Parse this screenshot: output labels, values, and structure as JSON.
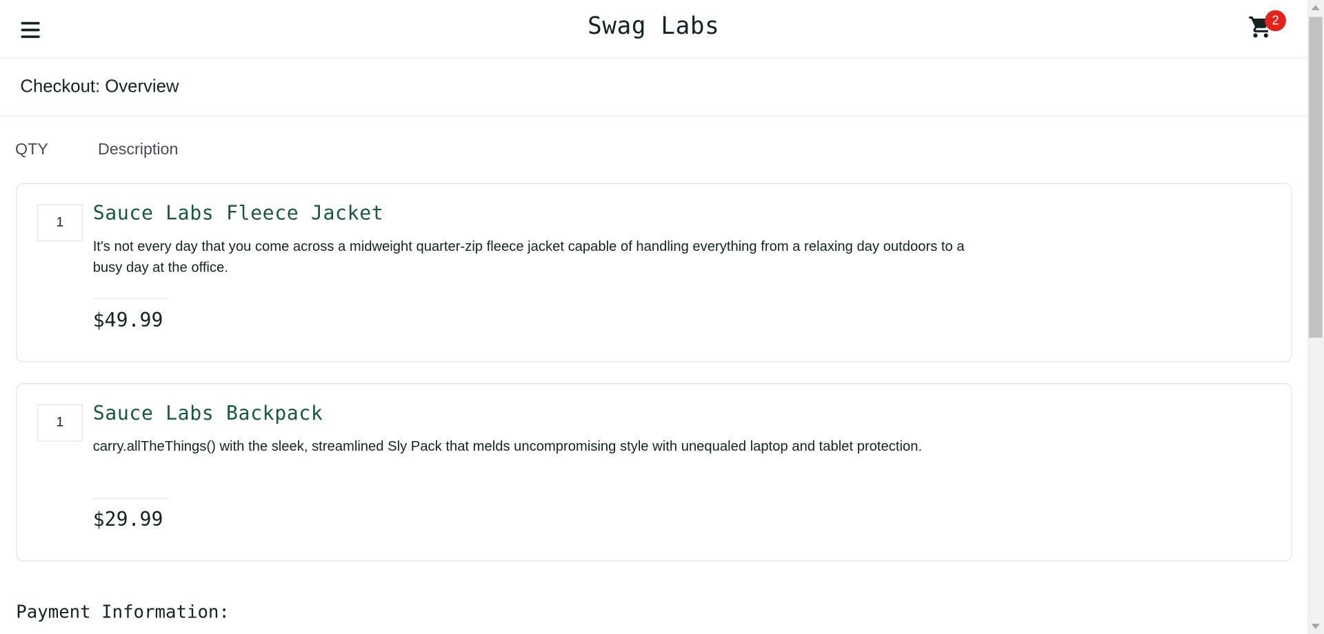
{
  "header": {
    "logo": "Swag Labs",
    "cart_count": "2"
  },
  "subheader": {
    "title": "Checkout: Overview"
  },
  "list_header": {
    "qty_label": "QTY",
    "desc_label": "Description"
  },
  "items": [
    {
      "qty": "1",
      "name": "Sauce Labs Fleece Jacket",
      "description": "It's not every day that you come across a midweight quarter-zip fleece jacket capable of handling everything from a relaxing day outdoors to a busy day at the office.",
      "price": "$49.99"
    },
    {
      "qty": "1",
      "name": "Sauce Labs Backpack",
      "description": "carry.allTheThings() with the sleek, streamlined Sly Pack that melds uncompromising style with unequaled laptop and tablet protection.",
      "price": "$29.99"
    }
  ],
  "summary": {
    "payment_label": "Payment Information:"
  },
  "colors": {
    "item_name": "#18583a",
    "badge": "#e2231a",
    "text": "#132322"
  },
  "icons": {
    "menu": "hamburger-menu-icon",
    "cart": "shopping-cart-icon"
  }
}
